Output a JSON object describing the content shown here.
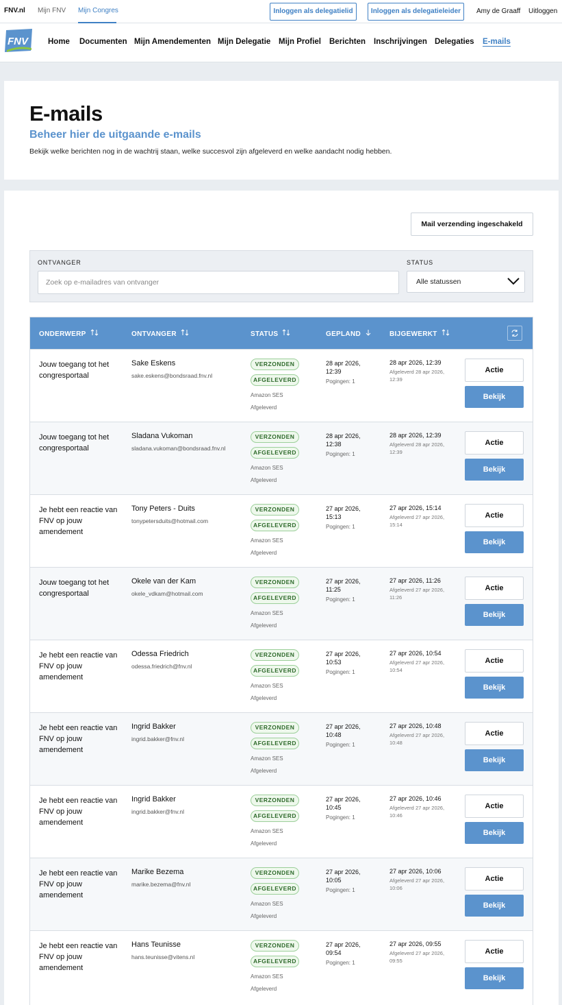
{
  "topbar": {
    "links": [
      "FNV.nl",
      "Mijn FNV",
      "Mijn Congres"
    ],
    "btn_delegatielid": "Inloggen als delegatielid",
    "btn_delegatieleider": "Inloggen als delegatieleider",
    "user": "Amy de Graaff",
    "logout": "Uitloggen"
  },
  "logo_text": "FNV",
  "nav": [
    "Home",
    "Documenten",
    "Mijn Amendementen",
    "Mijn Delegatie",
    "Mijn Profiel",
    "Berichten",
    "Inschrijvingen",
    "Delegaties",
    "E-mails"
  ],
  "header": {
    "title": "E-mails",
    "subtitle": "Beheer hier de uitgaande e-mails",
    "description": "Bekijk welke berichten nog in de wachtrij staan, welke succesvol zijn afgeleverd en welke aandacht nodig hebben."
  },
  "mail_toggle": "Mail verzending ingeschakeld",
  "filter": {
    "recipient_label": "ONTVANGER",
    "recipient_placeholder": "Zoek op e-mailadres van ontvanger",
    "status_label": "STATUS",
    "status_value": "Alle statussen"
  },
  "columns": [
    "ONDERWERP",
    "ONTVANGER",
    "STATUS",
    "GEPLAND",
    "BIJGEWERKT"
  ],
  "rows": [
    {
      "subject": "Jouw toegang tot het congresportaal",
      "name": "Sake Eskens",
      "email": "sake.eskens@bondsraad.fnv.nl",
      "status1": "VERZONDEN",
      "status2": "AFGELEVERD",
      "provider": "Amazon SES",
      "delivery": "Afgeleverd",
      "planned": "28 apr 2026, 12:39",
      "attempts": "Pogingen: 1",
      "updated": "28 apr 2026, 12:39",
      "updated_note": "Afgeleverd 28 apr 2026, 12:39",
      "action": "Actie",
      "view": "Bekijk"
    },
    {
      "subject": "Jouw toegang tot het congresportaal",
      "name": "Sladana Vukoman",
      "email": "sladana.vukoman@bondsraad.fnv.nl",
      "status1": "VERZONDEN",
      "status2": "AFGELEVERD",
      "provider": "Amazon SES",
      "delivery": "Afgeleverd",
      "planned": "28 apr 2026, 12:38",
      "attempts": "Pogingen: 1",
      "updated": "28 apr 2026, 12:39",
      "updated_note": "Afgeleverd 28 apr 2026, 12:39",
      "action": "Actie",
      "view": "Bekijk"
    },
    {
      "subject": "Je hebt een reactie van FNV op jouw amendement",
      "name": "Tony Peters - Duits",
      "email": "tonypetersduits@hotmail.com",
      "status1": "VERZONDEN",
      "status2": "AFGELEVERD",
      "provider": "Amazon SES",
      "delivery": "Afgeleverd",
      "planned": "27 apr 2026, 15:13",
      "attempts": "Pogingen: 1",
      "updated": "27 apr 2026, 15:14",
      "updated_note": "Afgeleverd 27 apr 2026, 15:14",
      "action": "Actie",
      "view": "Bekijk"
    },
    {
      "subject": "Jouw toegang tot het congresportaal",
      "name": "Okele van der Kam",
      "email": "okele_vdkam@hotmail.com",
      "status1": "VERZONDEN",
      "status2": "AFGELEVERD",
      "provider": "Amazon SES",
      "delivery": "Afgeleverd",
      "planned": "27 apr 2026, 11:25",
      "attempts": "Pogingen: 1",
      "updated": "27 apr 2026, 11:26",
      "updated_note": "Afgeleverd 27 apr 2026, 11:26",
      "action": "Actie",
      "view": "Bekijk"
    },
    {
      "subject": "Je hebt een reactie van FNV op jouw amendement",
      "name": "Odessa Friedrich",
      "email": "odessa.friedrich@fnv.nl",
      "status1": "VERZONDEN",
      "status2": "AFGELEVERD",
      "provider": "Amazon SES",
      "delivery": "Afgeleverd",
      "planned": "27 apr 2026, 10:53",
      "attempts": "Pogingen: 1",
      "updated": "27 apr 2026, 10:54",
      "updated_note": "Afgeleverd 27 apr 2026, 10:54",
      "action": "Actie",
      "view": "Bekijk"
    },
    {
      "subject": "Je hebt een reactie van FNV op jouw amendement",
      "name": "Ingrid Bakker",
      "email": "ingrid.bakker@fnv.nl",
      "status1": "VERZONDEN",
      "status2": "AFGELEVERD",
      "provider": "Amazon SES",
      "delivery": "Afgeleverd",
      "planned": "27 apr 2026, 10:48",
      "attempts": "Pogingen: 1",
      "updated": "27 apr 2026, 10:48",
      "updated_note": "Afgeleverd 27 apr 2026, 10:48",
      "action": "Actie",
      "view": "Bekijk"
    },
    {
      "subject": "Je hebt een reactie van FNV op jouw amendement",
      "name": "Ingrid Bakker",
      "email": "ingrid.bakker@fnv.nl",
      "status1": "VERZONDEN",
      "status2": "AFGELEVERD",
      "provider": "Amazon SES",
      "delivery": "Afgeleverd",
      "planned": "27 apr 2026, 10:45",
      "attempts": "Pogingen: 1",
      "updated": "27 apr 2026, 10:46",
      "updated_note": "Afgeleverd 27 apr 2026, 10:46",
      "action": "Actie",
      "view": "Bekijk"
    },
    {
      "subject": "Je hebt een reactie van FNV op jouw amendement",
      "name": "Marike Bezema",
      "email": "marike.bezema@fnv.nl",
      "status1": "VERZONDEN",
      "status2": "AFGELEVERD",
      "provider": "Amazon SES",
      "delivery": "Afgeleverd",
      "planned": "27 apr 2026, 10:05",
      "attempts": "Pogingen: 1",
      "updated": "27 apr 2026, 10:06",
      "updated_note": "Afgeleverd 27 apr 2026, 10:06",
      "action": "Actie",
      "view": "Bekijk"
    },
    {
      "subject": "Je hebt een reactie van FNV op jouw amendement",
      "name": "Hans Teunisse",
      "email": "hans.teunisse@vitens.nl",
      "status1": "VERZONDEN",
      "status2": "AFGELEVERD",
      "provider": "Amazon SES",
      "delivery": "Afgeleverd",
      "planned": "27 apr 2026, 09:54",
      "attempts": "Pogingen: 1",
      "updated": "27 apr 2026, 09:55",
      "updated_note": "Afgeleverd 27 apr 2026, 09:55",
      "action": "Actie",
      "view": "Bekijk"
    }
  ],
  "colors": {
    "accent": "#3f80c4",
    "header_blue": "#5b93cd",
    "badge_green": "#2e6a2b",
    "page_bg": "#e9edf1"
  },
  "icons": {
    "sort": "sort-icon",
    "sort_down": "sort-down-icon",
    "refresh": "refresh-icon",
    "chevron": "chevron-down-icon"
  }
}
